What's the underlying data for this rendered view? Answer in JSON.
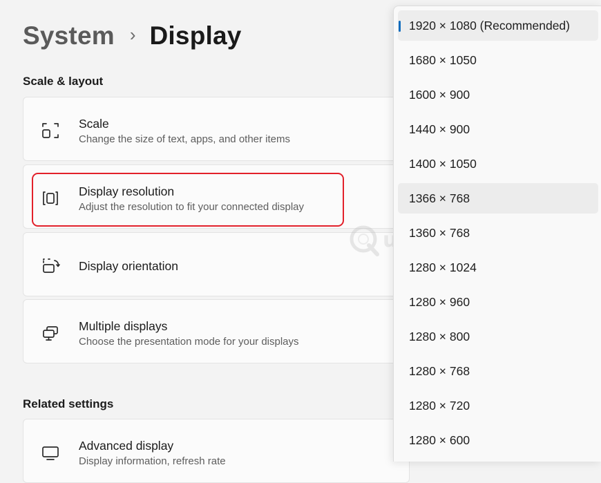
{
  "breadcrumb": {
    "parent": "System",
    "separator": "›",
    "current": "Display"
  },
  "sections": {
    "scale_layout": "Scale & layout",
    "related": "Related settings"
  },
  "cards": {
    "scale": {
      "title": "Scale",
      "desc": "Change the size of text, apps, and other items",
      "icon": "scale-icon"
    },
    "resolution": {
      "title": "Display resolution",
      "desc": "Adjust the resolution to fit your connected display",
      "icon": "resolution-icon"
    },
    "orientation": {
      "title": "Display orientation",
      "icon": "orientation-icon"
    },
    "multiple": {
      "title": "Multiple displays",
      "desc": "Choose the presentation mode for your displays",
      "icon": "multiple-displays-icon"
    },
    "advanced": {
      "title": "Advanced display",
      "desc": "Display information, refresh rate",
      "icon": "monitor-icon"
    }
  },
  "dropdown": {
    "options": [
      "1920 × 1080 (Recommended)",
      "1680 × 1050",
      "1600 × 900",
      "1440 × 900",
      "1400 × 1050",
      "1366 × 768",
      "1360 × 768",
      "1280 × 1024",
      "1280 × 960",
      "1280 × 800",
      "1280 × 768",
      "1280 × 720",
      "1280 × 600"
    ],
    "selected": "1920 × 1080 (Recommended)",
    "hovered": "1366 × 768"
  },
  "watermark": {
    "text": "uantrimang"
  },
  "colors": {
    "accent": "#0f6cbd",
    "highlight_border": "#e2202a",
    "background": "#f3f3f3",
    "card": "#fbfbfb"
  }
}
